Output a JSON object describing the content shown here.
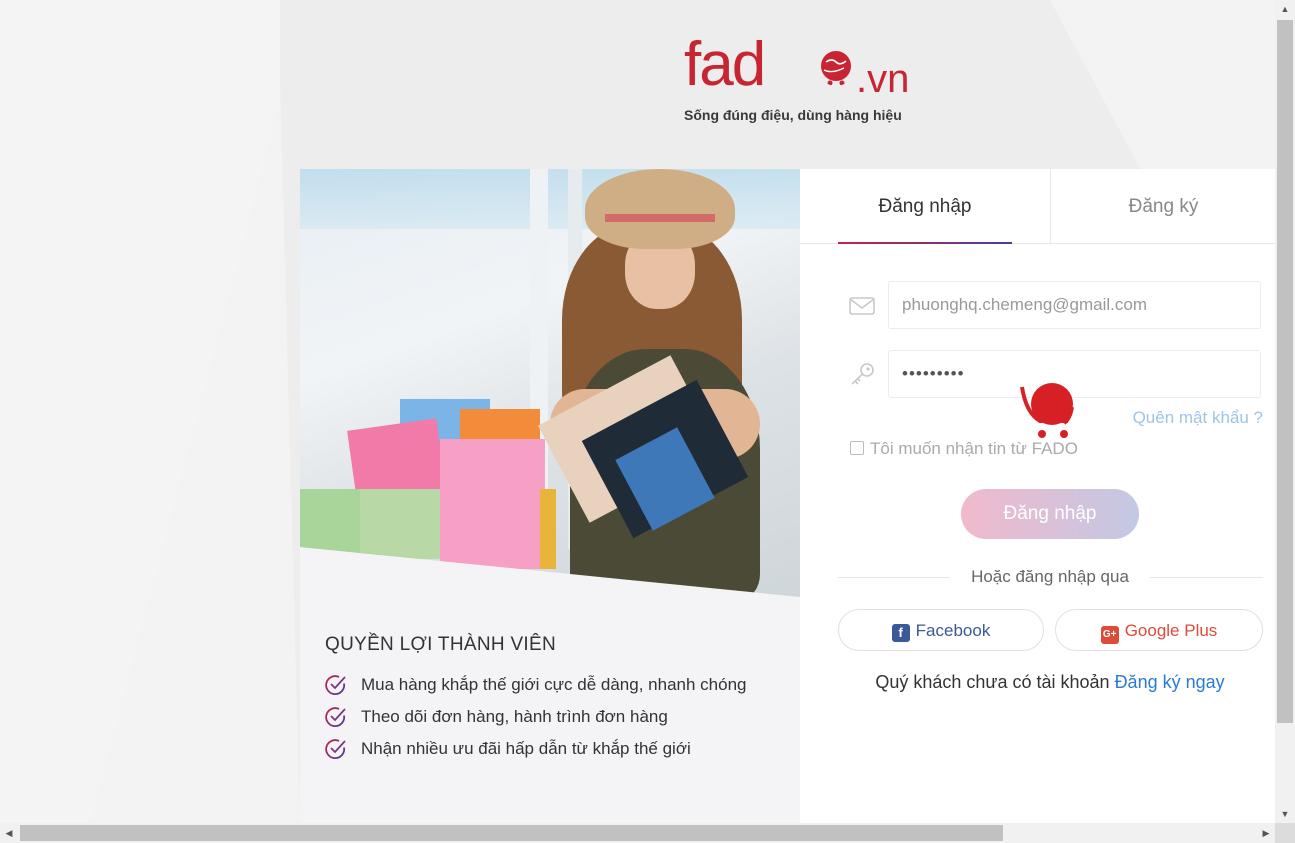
{
  "logo": {
    "word": "fad",
    "suffix": ".vn",
    "tagline": "Sống đúng điệu, dùng hàng hiệu"
  },
  "benefits": {
    "title": "QUYỀN LỢI THÀNH VIÊN",
    "items": [
      "Mua hàng khắp thế giới cực dễ dàng, nhanh chóng",
      "Theo dõi đơn hàng, hành trình đơn hàng",
      "Nhận nhiều ưu đãi hấp dẫn từ khắp thế giới"
    ]
  },
  "tabs": {
    "login": "Đăng nhập",
    "register": "Đăng ký"
  },
  "form": {
    "email_value": "phuonghq.chemeng@gmail.com",
    "password_value": "•••••••••",
    "forgot_label": "Quên mật khẩu ?",
    "remember_label": "Tôi muốn nhận tin từ FADO",
    "submit_label": "Đăng nhập",
    "or_label": "Hoặc đăng nhập qua",
    "facebook_label": "Facebook",
    "google_label": "Google Plus",
    "signup_prompt": "Quý khách chưa có tài khoản",
    "signup_link": "Đăng ký ngay"
  },
  "colors": {
    "brand_red": "#c62531",
    "link_blue": "#2b7bd6",
    "facebook": "#3b5998",
    "google": "#dd4b39"
  },
  "icons": {
    "email": "envelope-icon",
    "password": "key-icon",
    "check": "check-circle-icon",
    "facebook": "facebook-icon",
    "google": "google-plus-icon"
  }
}
